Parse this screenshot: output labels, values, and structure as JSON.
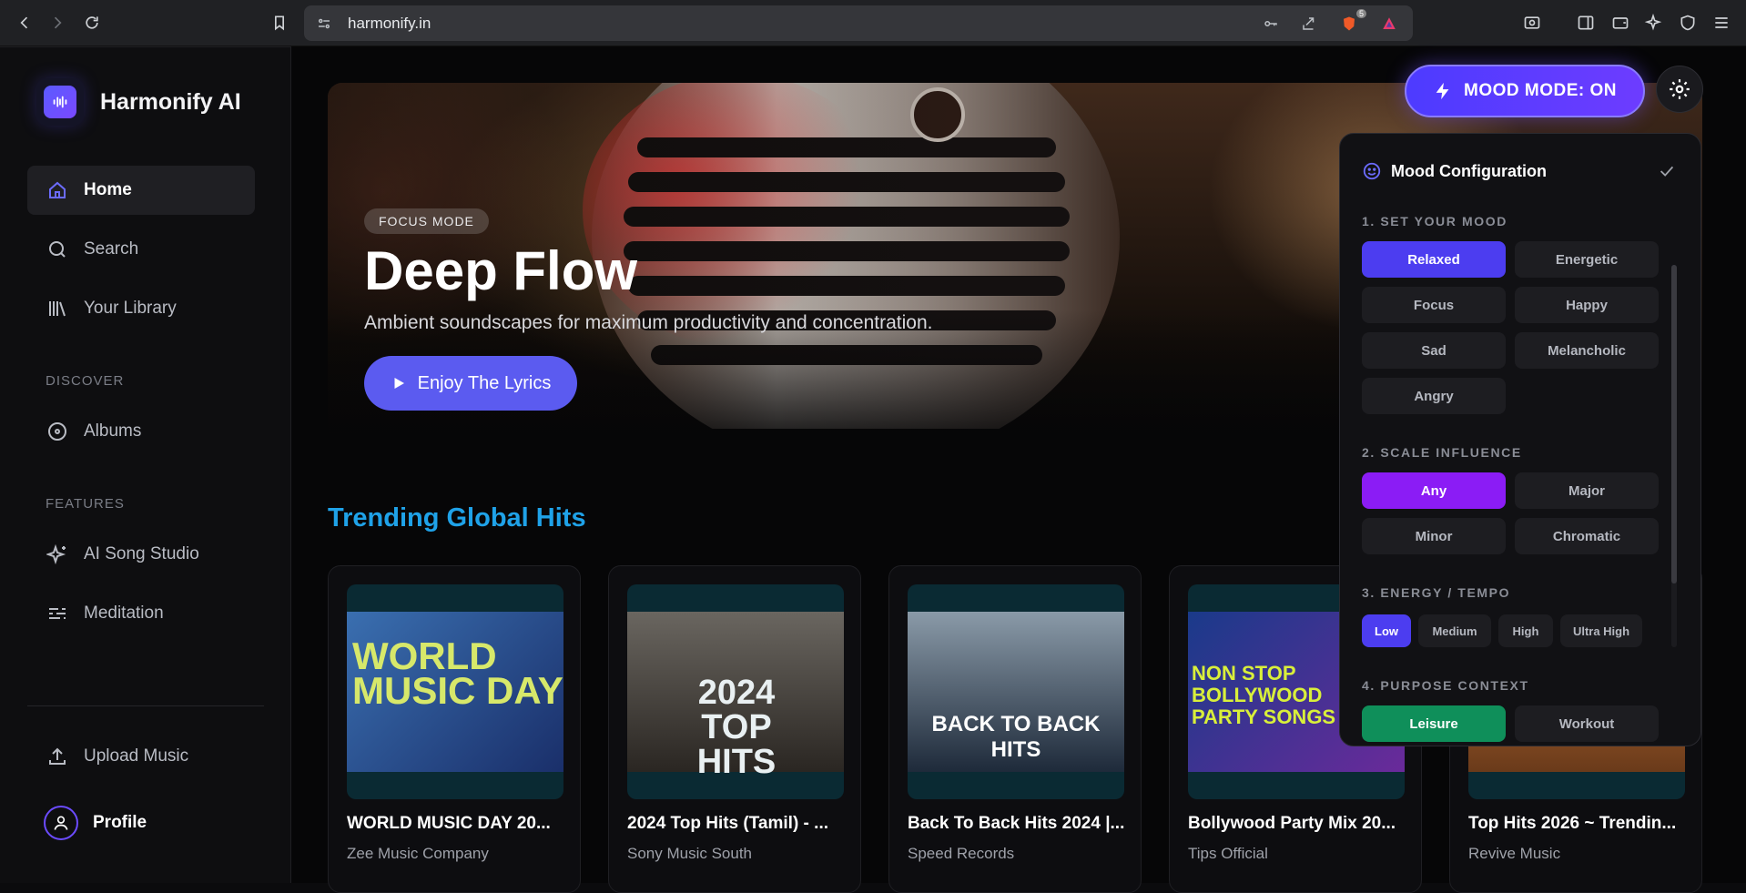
{
  "browser": {
    "url": "harmonify.in",
    "shield_count": "5"
  },
  "brand": {
    "name": "Harmonify AI"
  },
  "nav": {
    "home": "Home",
    "search": "Search",
    "library": "Your Library",
    "discover_label": "DISCOVER",
    "albums": "Albums",
    "features_label": "FEATURES",
    "ai_studio": "AI Song Studio",
    "meditation": "Meditation",
    "upload": "Upload Music",
    "profile": "Profile"
  },
  "hero": {
    "badge": "FOCUS MODE",
    "title": "Deep Flow",
    "subtitle": "Ambient soundscapes for maximum productivity and concentration.",
    "button": "Enjoy The Lyrics"
  },
  "trending": {
    "title": "Trending Global Hits",
    "cards": [
      {
        "title": "WORLD MUSIC DAY 20...",
        "artist": "Zee Music Company",
        "art": "WORLD MUSIC DAY"
      },
      {
        "title": "2024 Top Hits (Tamil) - ...",
        "artist": "Sony Music South",
        "art": "2024 TOP HITS"
      },
      {
        "title": "Back To Back Hits 2024 |...",
        "artist": "Speed Records",
        "art": "BACK TO BACK HITS"
      },
      {
        "title": "Bollywood Party Mix 20...",
        "artist": "Tips Official",
        "art": "NON STOP BOLLYWOOD PARTY SONGS"
      },
      {
        "title": "Top Hits 2026 ~ Trendin...",
        "artist": "Revive Music",
        "art": ""
      }
    ]
  },
  "mood": {
    "toggle_label": "MOOD MODE: ON",
    "panel_title": "Mood Configuration",
    "sections": {
      "mood": "1. SET YOUR MOOD",
      "scale": "2. SCALE INFLUENCE",
      "energy": "3. ENERGY / TEMPO",
      "purpose": "4. PURPOSE CONTEXT"
    },
    "moods": [
      "Relaxed",
      "Energetic",
      "Focus",
      "Happy",
      "Sad",
      "Melancholic",
      "Angry"
    ],
    "scales": [
      "Any",
      "Major",
      "Minor",
      "Chromatic"
    ],
    "energies": [
      "Low",
      "Medium",
      "High",
      "Ultra High"
    ],
    "purposes": [
      "Leisure",
      "Workout"
    ],
    "selected": {
      "mood": "Relaxed",
      "scale": "Any",
      "energy": "Low",
      "purpose": "Leisure"
    }
  },
  "colors": {
    "accent": "#5b5bf0",
    "trending_title": "#1fa2e8",
    "scale_selected": "#8b1cf5",
    "purpose_selected": "#0f8f5a"
  }
}
